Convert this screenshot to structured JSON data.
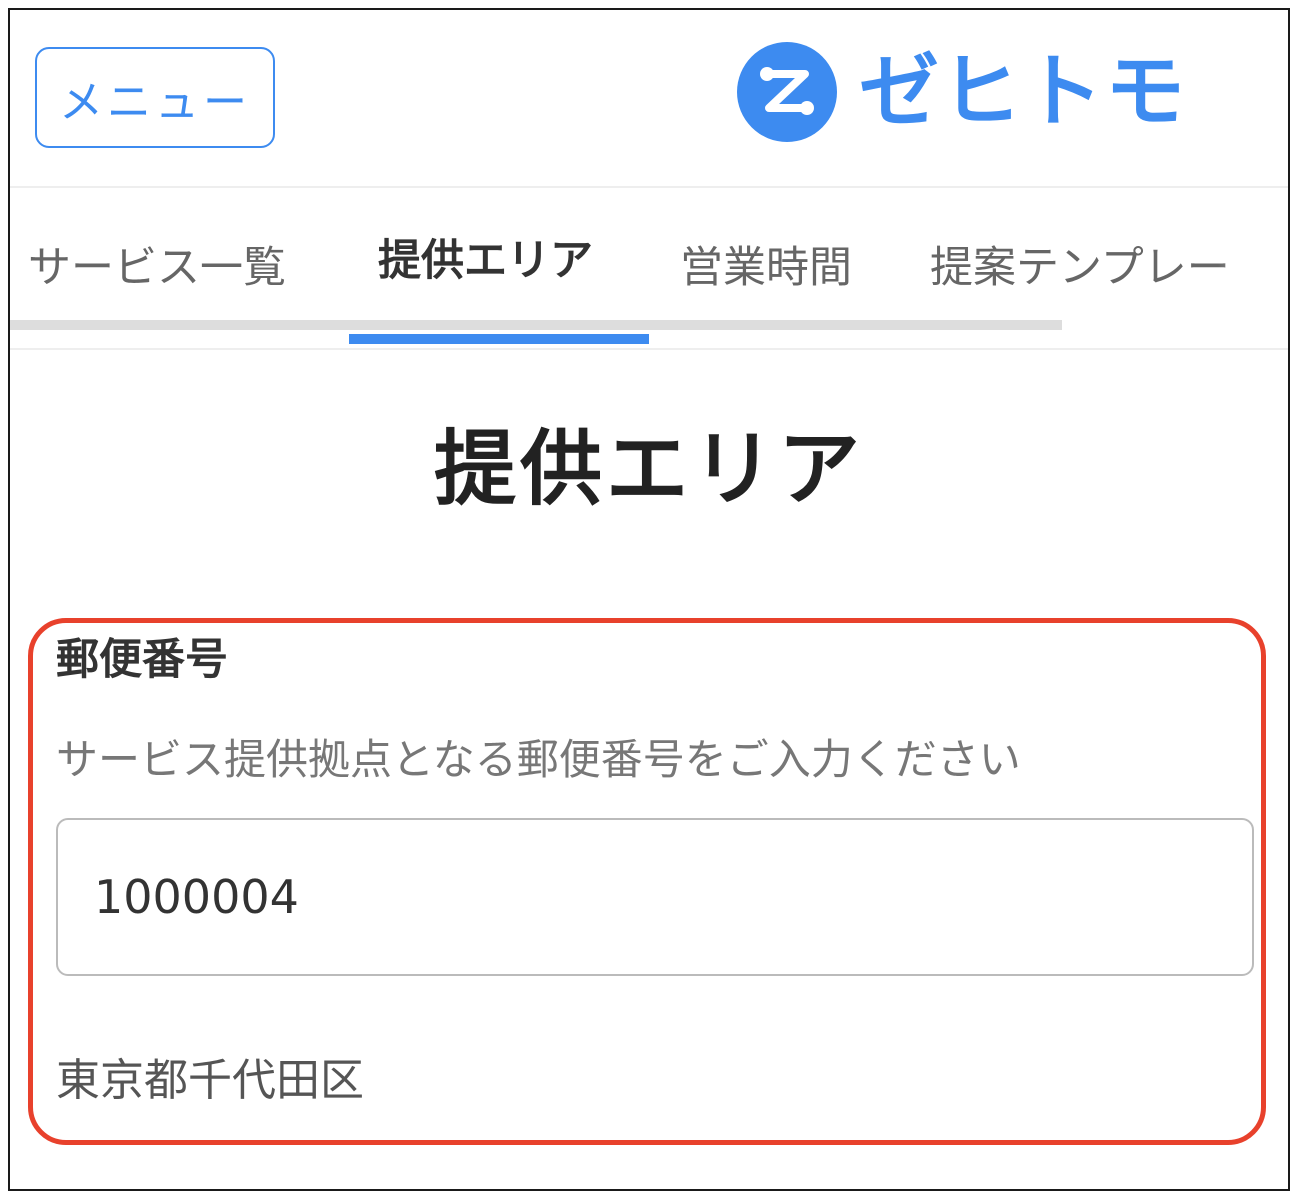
{
  "header": {
    "menu_label": "メニュー",
    "logo_text": "ゼヒトモ",
    "brand_color": "#3d8bf0"
  },
  "tabs": [
    {
      "label": "サービス一覧",
      "active": false
    },
    {
      "label": "提供エリア",
      "active": true
    },
    {
      "label": "営業時間",
      "active": false
    },
    {
      "label": "提案テンプレー",
      "active": false
    }
  ],
  "page": {
    "title": "提供エリア"
  },
  "postal_field": {
    "label": "郵便番号",
    "help_text": "サービス提供拠点となる郵便番号をご入力ください",
    "value": "1000004",
    "address": "東京都千代田区"
  },
  "highlight_color": "#e8412c"
}
